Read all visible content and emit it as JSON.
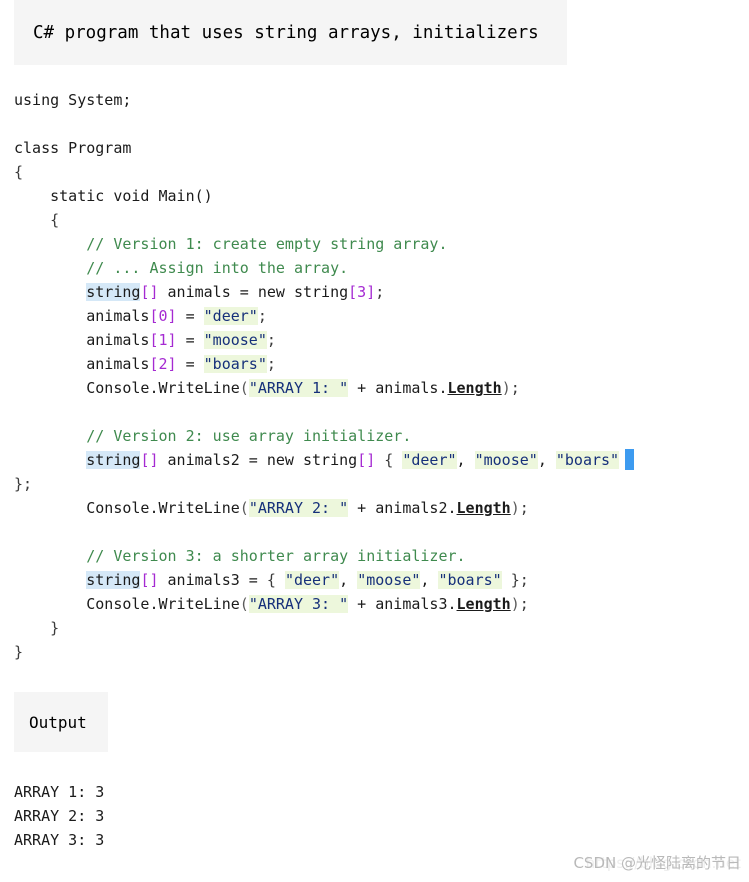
{
  "caption": {
    "text": "C# program that uses string arrays, initializers"
  },
  "code": {
    "lines": [
      {
        "segments": [
          {
            "t": "using System;",
            "c": "plain"
          }
        ]
      },
      {
        "segments": []
      },
      {
        "segments": [
          {
            "t": "class Program",
            "c": "plain"
          }
        ]
      },
      {
        "segments": [
          {
            "t": "{",
            "c": "punct"
          }
        ]
      },
      {
        "segments": [
          {
            "t": "    static void Main()",
            "c": "plain"
          }
        ]
      },
      {
        "segments": [
          {
            "t": "    {",
            "c": "punct"
          }
        ]
      },
      {
        "segments": [
          {
            "t": "        ",
            "c": "plain"
          },
          {
            "t": "// Version 1: create empty string array.",
            "c": "comment"
          }
        ]
      },
      {
        "segments": [
          {
            "t": "        ",
            "c": "plain"
          },
          {
            "t": "// ... Assign into the array.",
            "c": "comment"
          }
        ]
      },
      {
        "segments": [
          {
            "t": "        ",
            "c": "plain"
          },
          {
            "t": "string",
            "c": "keyword"
          },
          {
            "t": "[]",
            "c": "brackets"
          },
          {
            "t": " animals = new string",
            "c": "plain"
          },
          {
            "t": "[3]",
            "c": "brackets"
          },
          {
            "t": ";",
            "c": "punct"
          }
        ]
      },
      {
        "segments": [
          {
            "t": "        animals",
            "c": "plain"
          },
          {
            "t": "[0]",
            "c": "brackets"
          },
          {
            "t": " = ",
            "c": "plain"
          },
          {
            "t": "\"deer\"",
            "c": "string"
          },
          {
            "t": ";",
            "c": "punct"
          }
        ]
      },
      {
        "segments": [
          {
            "t": "        animals",
            "c": "plain"
          },
          {
            "t": "[1]",
            "c": "brackets"
          },
          {
            "t": " = ",
            "c": "plain"
          },
          {
            "t": "\"moose\"",
            "c": "string"
          },
          {
            "t": ";",
            "c": "punct"
          }
        ]
      },
      {
        "segments": [
          {
            "t": "        animals",
            "c": "plain"
          },
          {
            "t": "[2]",
            "c": "brackets"
          },
          {
            "t": " = ",
            "c": "plain"
          },
          {
            "t": "\"boars\"",
            "c": "string"
          },
          {
            "t": ";",
            "c": "punct"
          }
        ]
      },
      {
        "segments": [
          {
            "t": "        Console.WriteLine",
            "c": "plain"
          },
          {
            "t": "(",
            "c": "paren"
          },
          {
            "t": "\"ARRAY 1: \"",
            "c": "string"
          },
          {
            "t": " + animals.",
            "c": "plain"
          },
          {
            "t": "Length",
            "c": "prop"
          },
          {
            "t": ")",
            "c": "paren"
          },
          {
            "t": ";",
            "c": "punct"
          }
        ]
      },
      {
        "segments": []
      },
      {
        "segments": [
          {
            "t": "        ",
            "c": "plain"
          },
          {
            "t": "// Version 2: use array initializer.",
            "c": "comment"
          }
        ]
      },
      {
        "segments": [
          {
            "t": "        ",
            "c": "plain"
          },
          {
            "t": "string",
            "c": "keyword"
          },
          {
            "t": "[]",
            "c": "brackets"
          },
          {
            "t": " animals2 = new string",
            "c": "plain"
          },
          {
            "t": "[]",
            "c": "brackets"
          },
          {
            "t": " ",
            "c": "plain"
          },
          {
            "t": "{",
            "c": "punct"
          },
          {
            "t": " ",
            "c": "plain"
          },
          {
            "t": "\"deer\"",
            "c": "string"
          },
          {
            "t": ", ",
            "c": "plain"
          },
          {
            "t": "\"moose\"",
            "c": "string"
          },
          {
            "t": ", ",
            "c": "plain"
          },
          {
            "t": "\"boars\"",
            "c": "string"
          }
        ],
        "caret": true
      },
      {
        "segments": [
          {
            "t": "}",
            "c": "punct"
          },
          {
            "t": ";",
            "c": "punct"
          }
        ]
      },
      {
        "segments": [
          {
            "t": "        Console.WriteLine",
            "c": "plain"
          },
          {
            "t": "(",
            "c": "paren"
          },
          {
            "t": "\"ARRAY 2: \"",
            "c": "string"
          },
          {
            "t": " + animals2.",
            "c": "plain"
          },
          {
            "t": "Length",
            "c": "prop"
          },
          {
            "t": ")",
            "c": "paren"
          },
          {
            "t": ";",
            "c": "punct"
          }
        ]
      },
      {
        "segments": []
      },
      {
        "segments": [
          {
            "t": "        ",
            "c": "plain"
          },
          {
            "t": "// Version 3: a shorter array initializer.",
            "c": "comment"
          }
        ]
      },
      {
        "segments": [
          {
            "t": "        ",
            "c": "plain"
          },
          {
            "t": "string",
            "c": "keyword"
          },
          {
            "t": "[]",
            "c": "brackets"
          },
          {
            "t": " animals3 = ",
            "c": "plain"
          },
          {
            "t": "{",
            "c": "punct"
          },
          {
            "t": " ",
            "c": "plain"
          },
          {
            "t": "\"deer\"",
            "c": "string"
          },
          {
            "t": ", ",
            "c": "plain"
          },
          {
            "t": "\"moose\"",
            "c": "string"
          },
          {
            "t": ", ",
            "c": "plain"
          },
          {
            "t": "\"boars\"",
            "c": "string"
          },
          {
            "t": " ",
            "c": "plain"
          },
          {
            "t": "}",
            "c": "punct"
          },
          {
            "t": ";",
            "c": "punct"
          }
        ]
      },
      {
        "segments": [
          {
            "t": "        Console.WriteLine",
            "c": "plain"
          },
          {
            "t": "(",
            "c": "paren"
          },
          {
            "t": "\"ARRAY 3: \"",
            "c": "string"
          },
          {
            "t": " + animals3.",
            "c": "plain"
          },
          {
            "t": "Length",
            "c": "prop"
          },
          {
            "t": ")",
            "c": "paren"
          },
          {
            "t": ";",
            "c": "punct"
          }
        ]
      },
      {
        "segments": [
          {
            "t": "    }",
            "c": "punct"
          }
        ]
      },
      {
        "segments": [
          {
            "t": "}",
            "c": "punct"
          }
        ]
      }
    ]
  },
  "output": {
    "label": "Output",
    "lines": [
      "ARRAY 1: 3",
      "ARRAY 2: 3",
      "ARRAY 3: 3"
    ]
  },
  "watermark": {
    "text": "CSDN @光怪陆离的节日",
    "url_ghost": "https://blog.csdn.net"
  },
  "colors": {
    "panel_bg": "#f5f5f5",
    "comment": "#3f8a4e",
    "keyword_highlight": "#d5e8f7",
    "string_highlight": "#edf7dc",
    "string_text": "#16307a",
    "brackets": "#a52ad2",
    "caret": "#3d9bf0"
  }
}
